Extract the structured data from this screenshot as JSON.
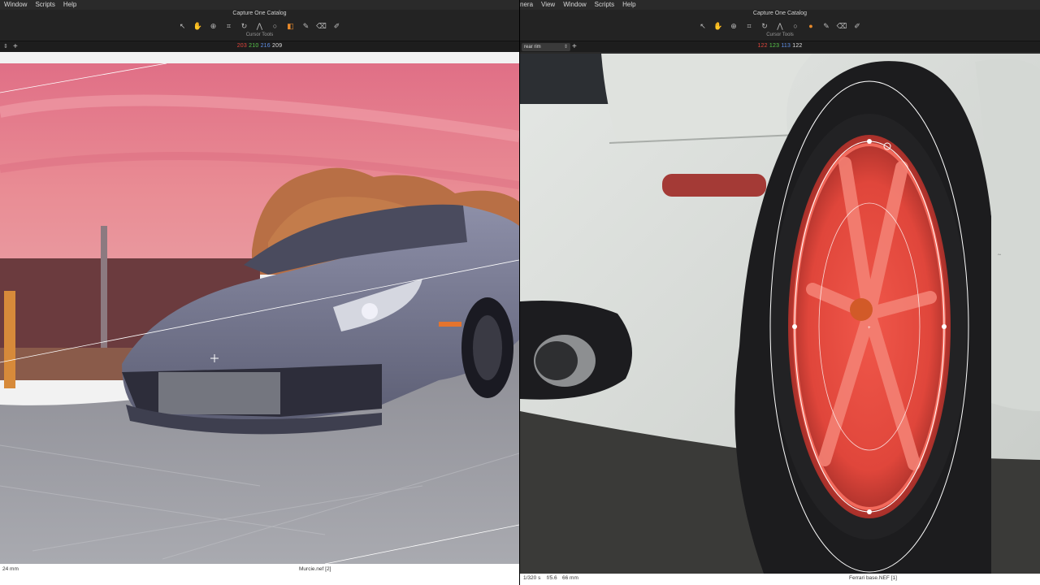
{
  "left": {
    "menu": [
      "Window",
      "Scripts",
      "Help"
    ],
    "catalog_title": "Capture One Catalog",
    "cursor_tools_label": "Cursor Tools",
    "readout": {
      "r": "203",
      "g": "210",
      "b": "216",
      "a": "209"
    },
    "status": {
      "focal": "24 mm",
      "filename": "Murcie.nef [2]"
    }
  },
  "right": {
    "menu": [
      "nera",
      "View",
      "Window",
      "Scripts",
      "Help"
    ],
    "catalog_title": "Capture One Catalog",
    "cursor_tools_label": "Cursor Tools",
    "layer_name": "rear rim",
    "readout": {
      "r": "122",
      "g": "123",
      "b": "113",
      "a": "122"
    },
    "status": {
      "shutter": "1/320 s",
      "aperture": "f/5.6",
      "focal": "66 mm",
      "filename": "Ferrari base.NEF [1]"
    }
  },
  "icons": [
    "select-icon",
    "hand-icon",
    "zoom-icon",
    "crop-icon",
    "rotate-icon",
    "keystone-icon",
    "spot-icon",
    "color-picker-icon",
    "mask-brush-icon",
    "erase-icon",
    "gradient-icon"
  ],
  "colors": {
    "mask_red": "#e0463b",
    "accent": "#e98a2b",
    "sky_pink": "#e27c88"
  }
}
